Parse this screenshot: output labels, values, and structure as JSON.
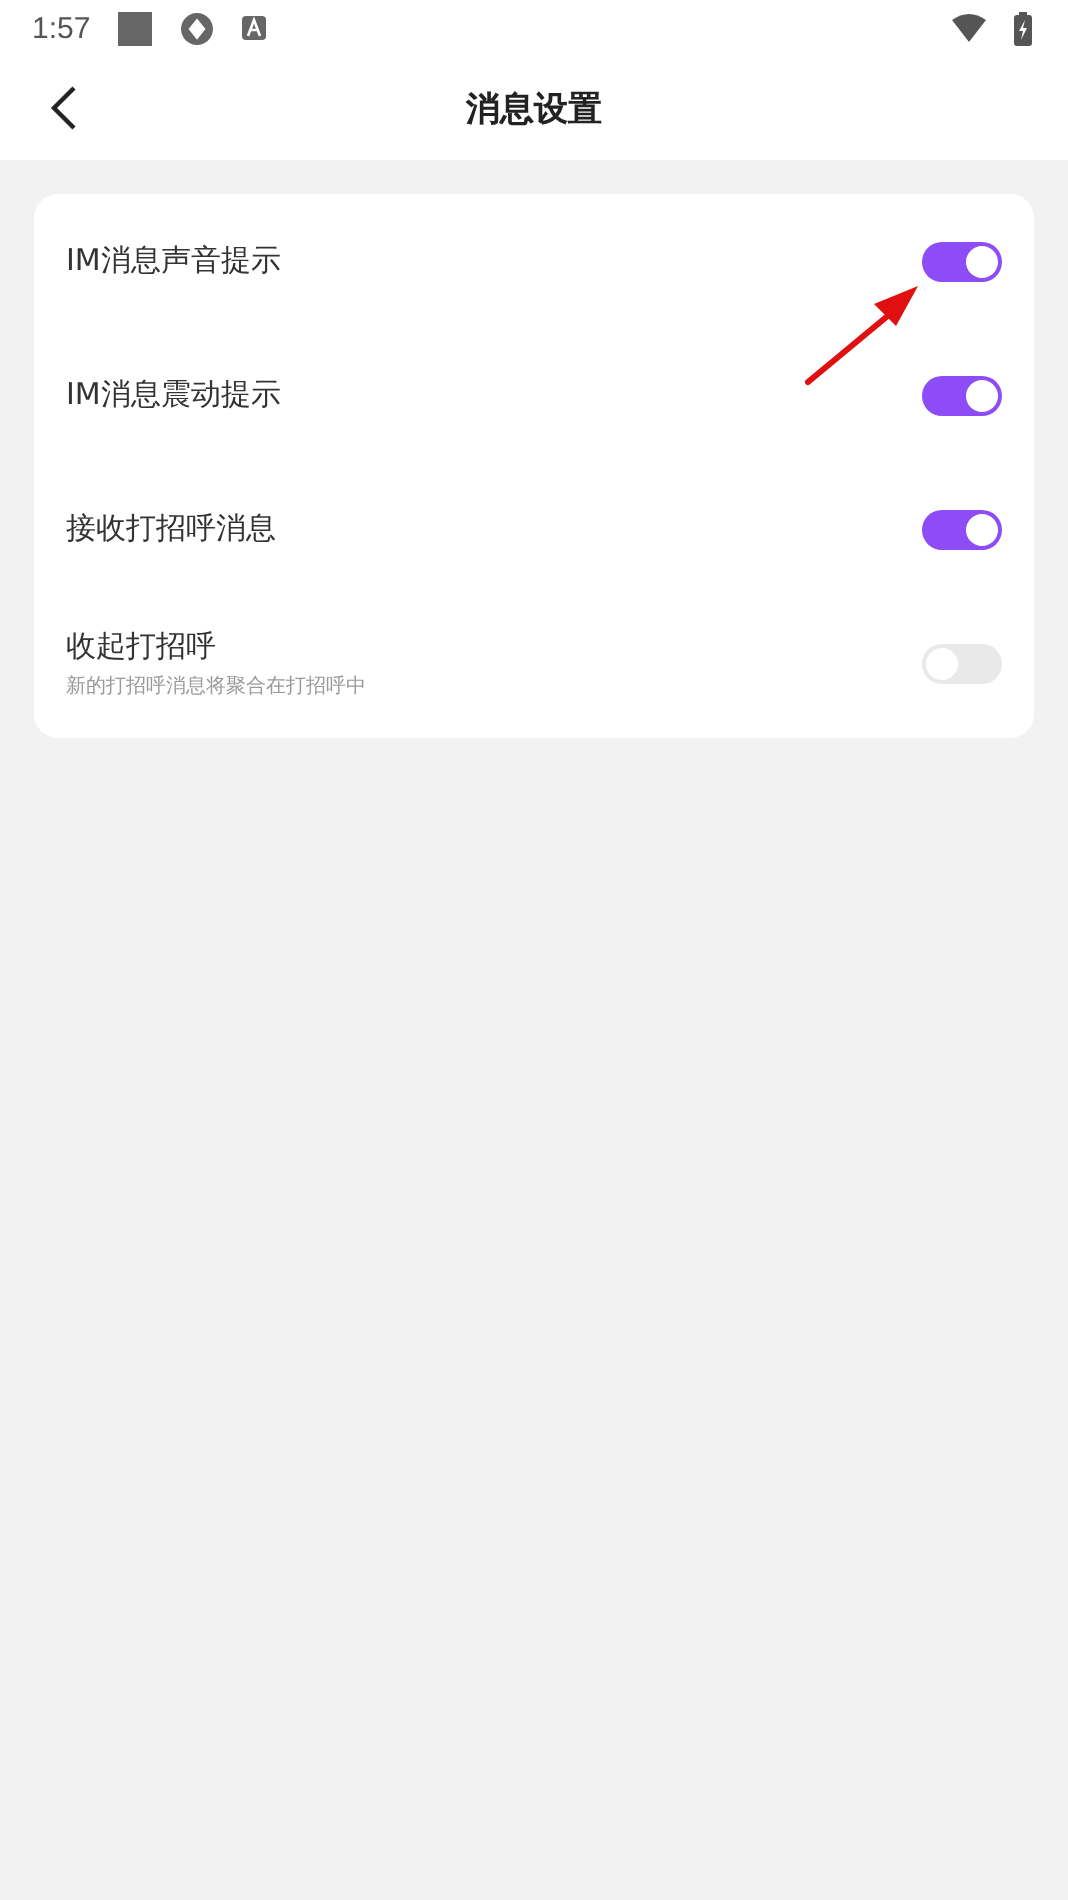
{
  "status_bar": {
    "time": "1:57"
  },
  "header": {
    "title": "消息设置"
  },
  "settings": [
    {
      "label": "IM消息声音提示",
      "on": true
    },
    {
      "label": "IM消息震动提示",
      "on": true
    },
    {
      "label": "接收打招呼消息",
      "on": true
    },
    {
      "label": "收起打招呼",
      "subtitle": "新的打招呼消息将聚合在打招呼中",
      "on": false
    }
  ]
}
